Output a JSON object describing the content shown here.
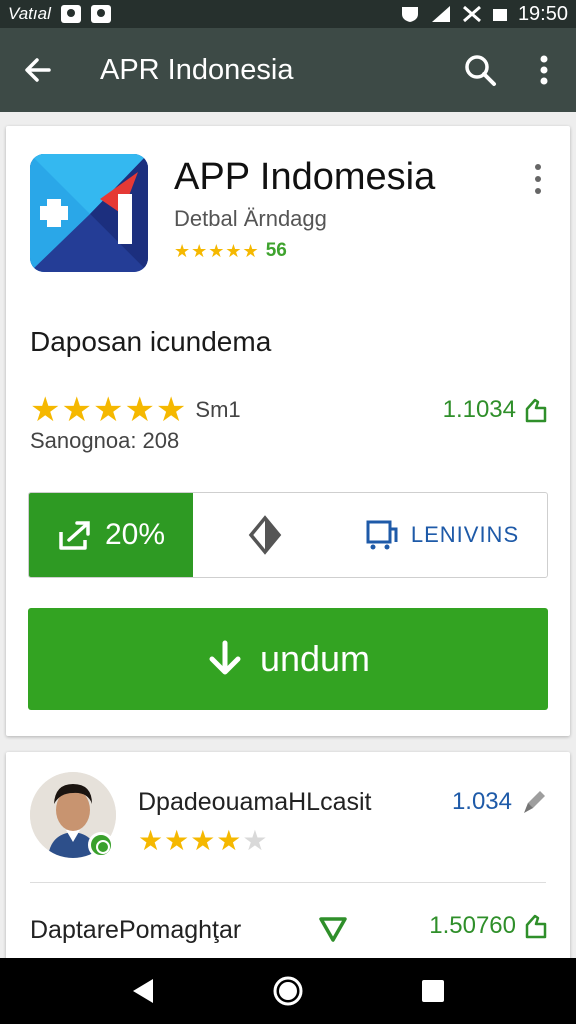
{
  "status_bar": {
    "carrier": "Vatıal",
    "time": "19:50"
  },
  "app_bar": {
    "title": "APR Indonesia"
  },
  "app": {
    "name": "APP Indomesia",
    "developer": "Detbal Ärndagg",
    "small_rating": "56",
    "small_stars": "★★★★★",
    "section_title": "Daposan icundema",
    "big_stars": "★★★★★",
    "rating_count": "Sm1",
    "rating_line2": "Sanognoa: 208",
    "downloads": "1.1034",
    "share_label": "20%",
    "review_label": "LENIVINS",
    "install_label": "undum",
    "colors": {
      "green": "#33a322",
      "blue": "#1e5aa8",
      "star": "#f5b800"
    }
  },
  "reviews": {
    "reviewer_name": "DpadeouamaHLcasit",
    "reviewer_stars_filled": "★★★★",
    "reviewer_stars_empty": "★",
    "reviewer_count": "1.034",
    "row2_name": "DaptarePomaghţar",
    "row2_count": "1.50760"
  },
  "icons": [
    "back-arrow-icon",
    "search-icon",
    "more-vert-icon",
    "share-icon",
    "diamond-icon",
    "review-icon",
    "download-icon",
    "thumb-icon",
    "pencil-icon",
    "triangle-icon"
  ]
}
